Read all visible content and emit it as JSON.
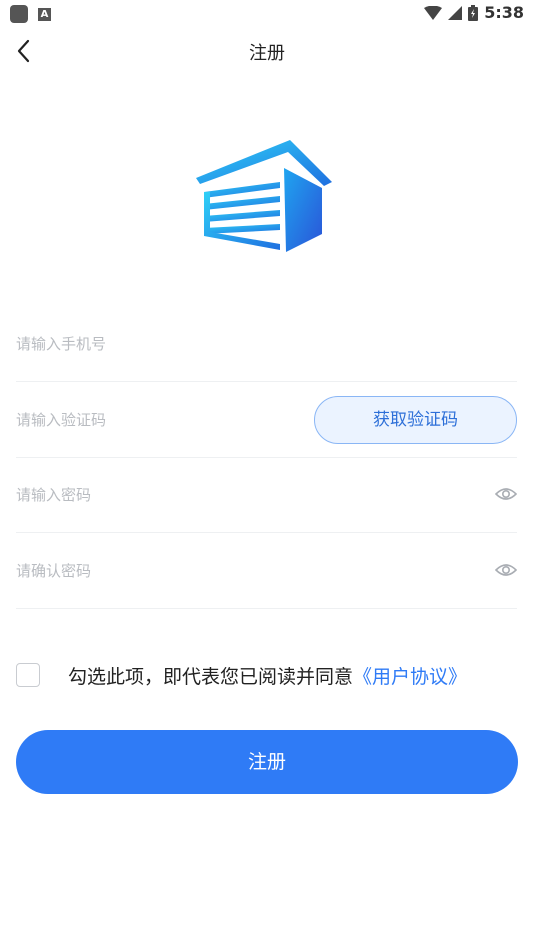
{
  "status_bar": {
    "time": "5:38",
    "badge": "A"
  },
  "nav": {
    "title": "注册"
  },
  "form": {
    "phone_placeholder": "请输入手机号",
    "code_placeholder": "请输入验证码",
    "code_button": "获取验证码",
    "password_placeholder": "请输入密码",
    "confirm_placeholder": "请确认密码"
  },
  "agreement": {
    "text": "勾选此项，即代表您已阅读并同意",
    "link": "《用户协议》",
    "checked": false
  },
  "submit_label": "注册",
  "colors": {
    "primary": "#2f7bf6",
    "logo_light": "#29c4f5",
    "logo_dark": "#1f6fe0"
  }
}
